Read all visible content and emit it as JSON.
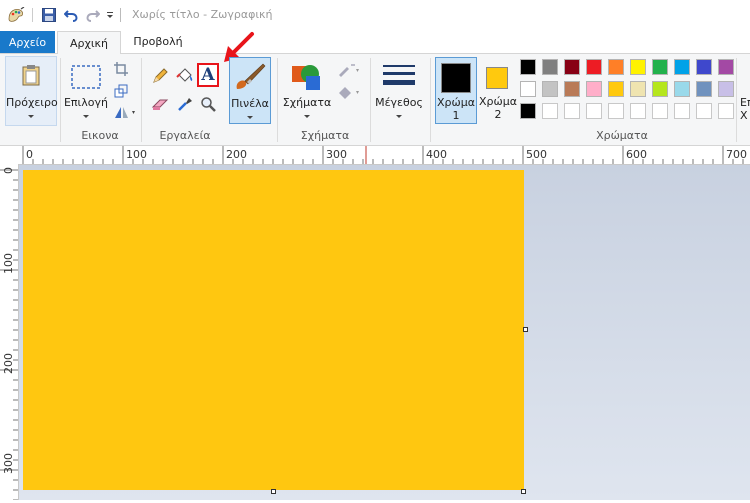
{
  "window": {
    "title": "Χωρίς τίτλο - Ζωγραφική"
  },
  "menu": {
    "file_label": "Αρχείο",
    "tabs": [
      {
        "label": "Αρχική"
      },
      {
        "label": "Προβολή"
      }
    ]
  },
  "ribbon": {
    "clipboard": {
      "label": "Πρόχειρο"
    },
    "image": {
      "group_label": "Εικονα",
      "select_label": "Επιλογή"
    },
    "tools": {
      "group_label": "Εργαλεία",
      "text_tool_glyph": "A"
    },
    "brushes": {
      "label": "Πινέλα"
    },
    "shapes": {
      "label": "Σχήματα",
      "group_label": "Σχήματα"
    },
    "size": {
      "label": "Μέγεθος"
    },
    "colors": {
      "color1_label": "Χρώμα",
      "color1_num": "1",
      "color1_value": "#000000",
      "color2_label": "Χρώμα",
      "color2_num": "2",
      "color2_value": "#ffc90e",
      "group_label": "Χρώματα",
      "edit_label_line1": "Επ",
      "edit_label_line2": "Χ",
      "palette_row1": [
        "#000000",
        "#7f7f7f",
        "#880015",
        "#ed1c24",
        "#ff7f27",
        "#fff200",
        "#22b14c",
        "#00a2e8",
        "#3f48cc",
        "#a349a4"
      ],
      "palette_row2": [
        "#ffffff",
        "#c3c3c3",
        "#b97a57",
        "#ffaec9",
        "#ffc90e",
        "#efe4b0",
        "#b5e61d",
        "#99d9ea",
        "#7092be",
        "#c8bfe7"
      ]
    }
  },
  "ruler": {
    "top_labels": [
      "0",
      "100",
      "200",
      "300",
      "400",
      "500",
      "600",
      "700"
    ],
    "left_labels": [
      "0",
      "100",
      "200",
      "300"
    ]
  },
  "colors": {
    "canvas": "#ffc710",
    "accent": "#1979ca",
    "annotation": "#e8141a"
  }
}
